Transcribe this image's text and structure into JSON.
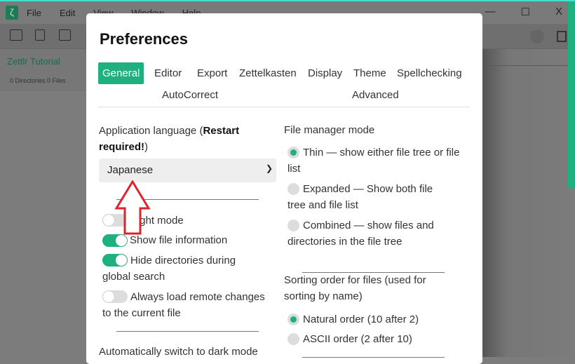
{
  "app": {
    "menu": [
      "File",
      "Edit",
      "View",
      "Window",
      "Help"
    ],
    "logo": "ζ",
    "sidebar_title": "Zettlr Tutorial",
    "sidebar_stats": "0 Directories   0 Files"
  },
  "window_controls": {
    "minimize": "—",
    "maximize": "☐",
    "close": "X"
  },
  "dialog": {
    "title": "Preferences",
    "tabs": [
      {
        "label": "General",
        "active": true
      },
      {
        "label": "Editor"
      },
      {
        "label": "Export"
      },
      {
        "label": "Zettelkasten"
      },
      {
        "label": "Display"
      },
      {
        "label": "Theme"
      },
      {
        "label": "Spellchecking"
      },
      {
        "label": "AutoCorrect"
      },
      {
        "label": "Advanced"
      }
    ],
    "language": {
      "label_pre": "Application language (",
      "label_bold": "Restart required!",
      "label_post": ")",
      "value": "Japanese"
    },
    "toggles": [
      {
        "label": "Night mode",
        "on": false
      },
      {
        "label": "Show file information",
        "on": true
      },
      {
        "label": "Hide directories during global search",
        "on": true
      },
      {
        "label": "Always load remote changes to the current file",
        "on": false
      }
    ],
    "dark_mode_label": "Automatically switch to dark mode",
    "file_manager": {
      "label": "File manager mode",
      "options": [
        {
          "label": "Thin — show either file tree or file list",
          "selected": true
        },
        {
          "label": "Expanded — Show both file tree and file list",
          "selected": false
        },
        {
          "label": "Combined — show files and directories in the file tree",
          "selected": false
        }
      ]
    },
    "sorting": {
      "label": "Sorting order for files (used for sorting by name)",
      "options": [
        {
          "label": "Natural order (10 after 2)",
          "selected": true
        },
        {
          "label": "ASCII order (2 after 10)",
          "selected": false
        }
      ]
    }
  },
  "colors": {
    "accent": "#1fb07f",
    "annotation_arrow": "#e0232b"
  }
}
